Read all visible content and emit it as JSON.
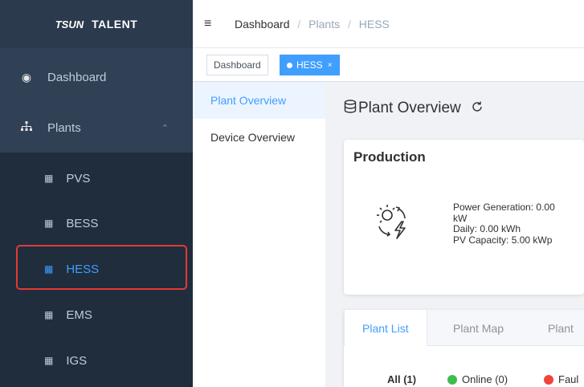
{
  "logo": {
    "mark": "TSUN",
    "name": "TALENT"
  },
  "sidebar": {
    "dashboard": "Dashboard",
    "plants": "Plants",
    "sub_items": [
      "PVS",
      "BESS",
      "HESS",
      "EMS",
      "IGS"
    ],
    "active": "HESS"
  },
  "breadcrumb": {
    "home": "Dashboard",
    "sep": "/",
    "level1": "Plants",
    "level2": "HESS"
  },
  "tags": {
    "dashboard": "Dashboard",
    "hess": "HESS"
  },
  "submenu": {
    "plant_overview": "Plant Overview",
    "device_overview": "Device Overview"
  },
  "page": {
    "title": "Plant Overview"
  },
  "production": {
    "title": "Production",
    "power": "Power Generation: 0.00 kW",
    "daily": "Daily: 0.00 kWh",
    "capacity": "PV Capacity: 5.00 kWp"
  },
  "tabs": {
    "list": "Plant List",
    "map": "Plant Map",
    "third": "Plant"
  },
  "status": {
    "all": "All (1)",
    "online": "Online (0)",
    "fault": "Faul"
  },
  "colors": {
    "accent": "#409eff",
    "online": "#3dbd4f",
    "fault": "#f0443a",
    "sidebar": "#304156"
  }
}
